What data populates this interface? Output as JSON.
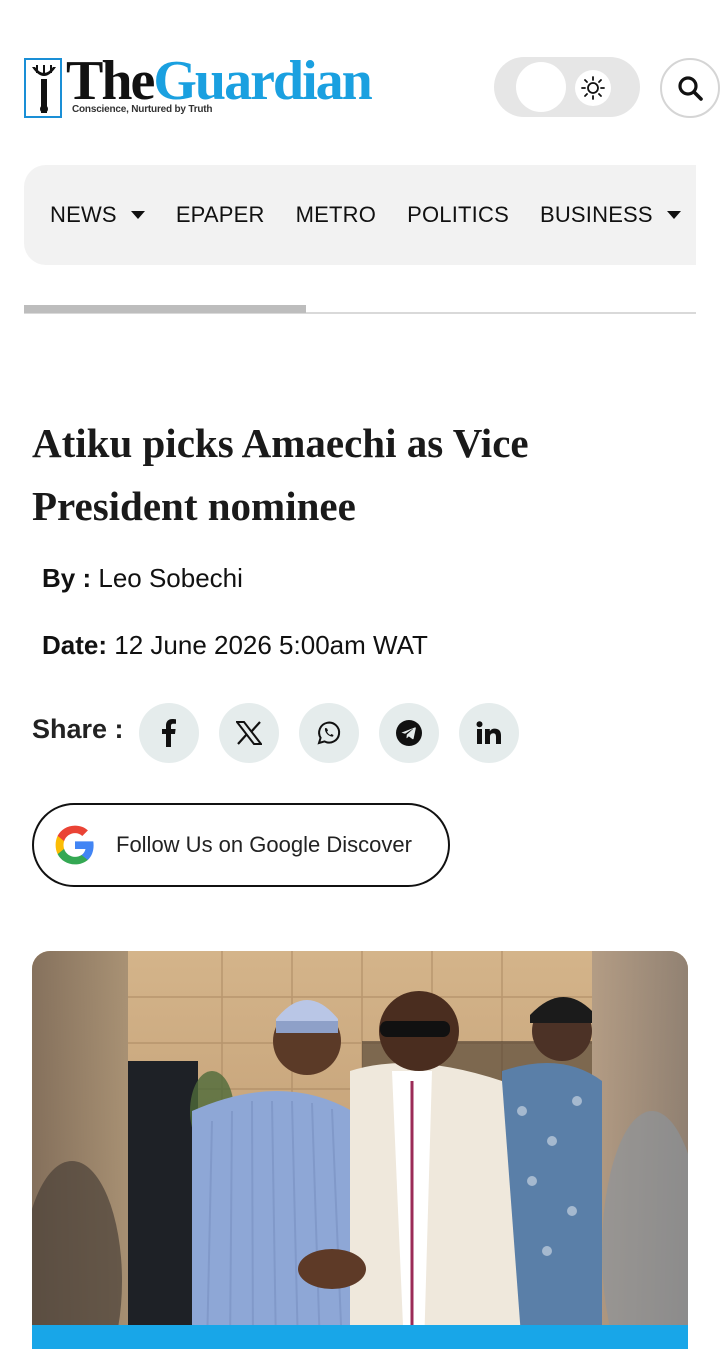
{
  "brand": {
    "name_the": "The",
    "name_guardian": "Guardian",
    "tagline": "Conscience, Nurtured by Truth",
    "accent_color": "#1aa0e0"
  },
  "header": {
    "theme_toggle_icon": "sun-icon",
    "search_icon": "search-icon"
  },
  "nav": {
    "items": [
      {
        "label": "NEWS",
        "has_dropdown": true
      },
      {
        "label": "EPAPER",
        "has_dropdown": false
      },
      {
        "label": "METRO",
        "has_dropdown": false
      },
      {
        "label": "POLITICS",
        "has_dropdown": false
      },
      {
        "label": "BUSINESS",
        "has_dropdown": true
      }
    ],
    "scroll_progress": 0.42
  },
  "article": {
    "headline": "Atiku picks Amaechi as Vice President nominee",
    "by_label": "By :",
    "author": "Leo Sobechi",
    "date_label": "Date:",
    "date": "12 June 2026 5:00am WAT",
    "share_label": "Share :",
    "share_buttons": [
      "facebook-icon",
      "x-icon",
      "whatsapp-icon",
      "telegram-icon",
      "linkedin-icon"
    ],
    "discover_label": "Follow Us on Google Discover"
  },
  "colors": {
    "photo_bar": "#18a6e8",
    "share_bg": "#e5ecec",
    "nav_bg": "#f2f2f2"
  }
}
